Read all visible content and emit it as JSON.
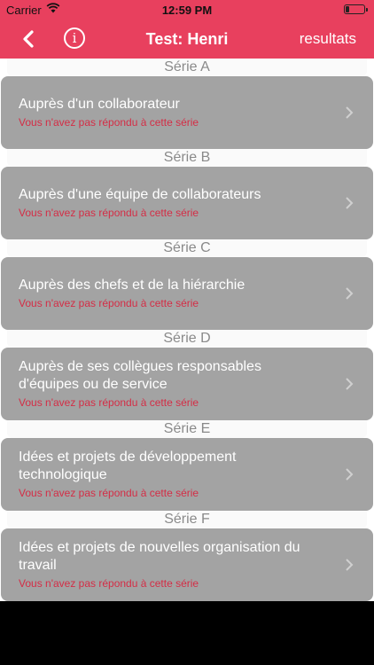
{
  "status_bar": {
    "carrier": "Carrier",
    "time": "12:59 PM",
    "icons": [
      "wifi-icon",
      "battery-icon"
    ]
  },
  "navbar": {
    "back_icon": "chevron-left-icon",
    "info_label": "i",
    "title": "Test: Henri",
    "results_label": "resultats"
  },
  "colors": {
    "accent": "#e8405e",
    "card": "#a3a3a3",
    "status_text": "#d42d46",
    "header_text": "#8a8a8a"
  },
  "series": [
    {
      "header": "Série A",
      "title": "Auprès d'un collaborateur",
      "status": "Vous n'avez pas répondu à cette série"
    },
    {
      "header": "Série B",
      "title": "Auprès d'une équipe de collaborateurs",
      "status": "Vous n'avez pas répondu à cette série"
    },
    {
      "header": "Série C",
      "title": "Auprès des chefs et de la hiérarchie",
      "status": "Vous n'avez pas répondu à cette série"
    },
    {
      "header": "Série D",
      "title": "Auprès de ses collègues responsables d'équipes ou de service",
      "status": "Vous n'avez pas répondu à cette série"
    },
    {
      "header": "Série E",
      "title": "Idées et projets de développement technologique",
      "status": "Vous n'avez pas répondu à cette série"
    },
    {
      "header": "Série F",
      "title": "Idées et projets de nouvelles organisation du travail",
      "status": "Vous n'avez pas répondu à cette série"
    }
  ]
}
